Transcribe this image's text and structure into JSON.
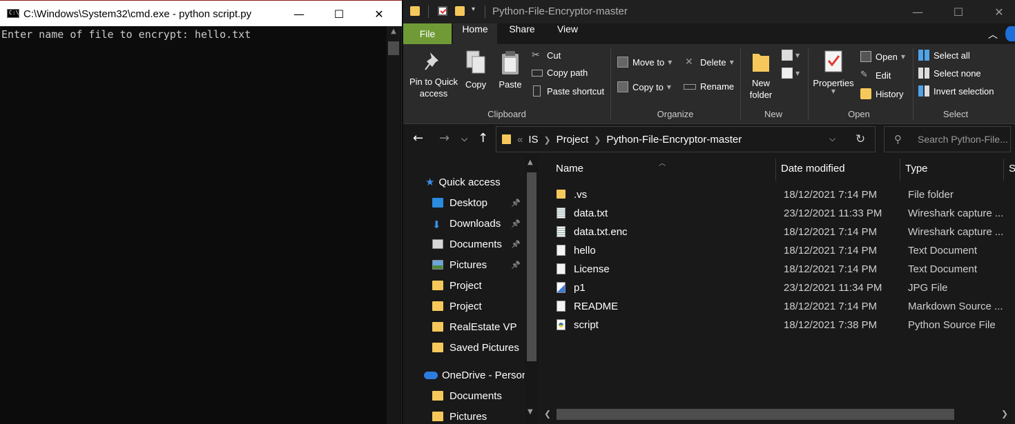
{
  "cmd": {
    "title": "C:\\Windows\\System32\\cmd.exe - python  script.py",
    "icon_text": "C:\\",
    "prompt_line": "Enter name of file to encrypt: hello.txt",
    "controls": {
      "minimize": "—",
      "maximize": "☐",
      "close": "✕"
    }
  },
  "explorer": {
    "title": "Python-File-Encryptor-master",
    "quick_access_dropdown": "▾",
    "controls": {
      "minimize": "—",
      "maximize": "☐",
      "close": "✕"
    },
    "ribbon_tabs": [
      "File",
      "Home",
      "Share",
      "View"
    ],
    "active_tab": "Home",
    "ribbon": {
      "clipboard": {
        "label": "Clipboard",
        "pin": "Pin to Quick access",
        "copy": "Copy",
        "paste": "Paste",
        "cut": "Cut",
        "copy_path": "Copy path",
        "paste_shortcut": "Paste shortcut"
      },
      "organize": {
        "label": "Organize",
        "move_to": "Move to",
        "copy_to": "Copy to",
        "delete": "Delete",
        "rename": "Rename"
      },
      "new": {
        "label": "New",
        "new_folder": "New folder"
      },
      "open": {
        "label": "Open",
        "properties": "Properties",
        "open": "Open",
        "edit": "Edit",
        "history": "History"
      },
      "select": {
        "label": "Select",
        "select_all": "Select all",
        "select_none": "Select none",
        "invert_selection": "Invert selection"
      }
    },
    "address": {
      "prefix": "«",
      "crumbs": [
        "IS",
        "Project",
        "Python-File-Encryptor-master"
      ]
    },
    "search": {
      "placeholder": "Search Python-File..."
    },
    "nav": {
      "quick_access": "Quick access",
      "items": [
        {
          "label": "Desktop",
          "icon": "desktop-icon",
          "pinned": true
        },
        {
          "label": "Downloads",
          "icon": "downloads-icon",
          "pinned": true
        },
        {
          "label": "Documents",
          "icon": "documents-icon",
          "pinned": true
        },
        {
          "label": "Pictures",
          "icon": "pictures-icon",
          "pinned": true
        },
        {
          "label": "Project",
          "icon": "folder-icon",
          "pinned": false
        },
        {
          "label": "Project",
          "icon": "folder-icon",
          "pinned": false
        },
        {
          "label": "RealEstate VP",
          "icon": "folder-icon",
          "pinned": false
        },
        {
          "label": "Saved Pictures",
          "icon": "folder-icon",
          "pinned": false
        }
      ],
      "onedrive": "OneDrive - Person",
      "onedrive_items": [
        {
          "label": "Documents",
          "icon": "folder-icon"
        },
        {
          "label": "Pictures",
          "icon": "folder-icon"
        }
      ]
    },
    "columns": {
      "name": "Name",
      "date": "Date modified",
      "type": "Type",
      "size": "S"
    },
    "files": [
      {
        "name": ".vs",
        "date": "18/12/2021 7:14 PM",
        "type": "File folder",
        "icon": "folder"
      },
      {
        "name": "data.txt",
        "date": "23/12/2021 11:33 PM",
        "type": "Wireshark capture ...",
        "icon": "doc-lines"
      },
      {
        "name": "data.txt.enc",
        "date": "18/12/2021 7:14 PM",
        "type": "Wireshark capture ...",
        "icon": "doc-lines"
      },
      {
        "name": "hello",
        "date": "18/12/2021 7:14 PM",
        "type": "Text Document",
        "icon": "doc"
      },
      {
        "name": "License",
        "date": "18/12/2021 7:14 PM",
        "type": "Text Document",
        "icon": "doc"
      },
      {
        "name": "p1",
        "date": "23/12/2021 11:34 PM",
        "type": "JPG File",
        "icon": "jpg"
      },
      {
        "name": "README",
        "date": "18/12/2021 7:14 PM",
        "type": "Markdown Source ...",
        "icon": "doc"
      },
      {
        "name": "script",
        "date": "18/12/2021 7:38 PM",
        "type": "Python Source File",
        "icon": "py"
      }
    ],
    "colors": {
      "file_tab": "#6f9a36",
      "folder": "#f6c85b",
      "accent": "#1e6fd9"
    }
  }
}
